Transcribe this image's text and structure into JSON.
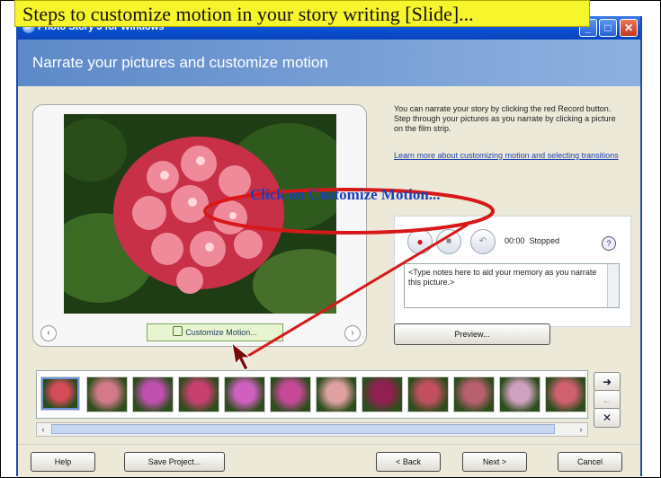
{
  "caption": "Steps to customize motion in your story writing [Slide]...",
  "window": {
    "title": "Photo Story 3 for Windows",
    "minimize_label": "_",
    "maximize_label": "□",
    "close_label": "✕"
  },
  "header": {
    "title": "Narrate your pictures and customize motion"
  },
  "preview": {
    "annotation": "Click on Customize Motion...",
    "prev_label": "‹",
    "next_label": "›",
    "customize_motion_label": "Customize Motion..."
  },
  "info": {
    "text": "You can narrate your story by clicking the red Record button. Step through your pictures as you narrate by clicking a picture on the film strip.",
    "link": "Learn more about customizing motion and selecting transitions"
  },
  "recording": {
    "record_icon": "●",
    "stop_icon": "■",
    "undo_icon": "↶",
    "time": "00:00",
    "status": "Stopped",
    "help_icon": "?",
    "notes_placeholder": "<Type notes here to aid your memory as you narrate this picture.>"
  },
  "preview_button": "Preview...",
  "filmstrip": {
    "thumbs": [
      {
        "c": "#d84a5a"
      },
      {
        "c": "#d27a8a"
      },
      {
        "c": "#c050b0"
      },
      {
        "c": "#c94070"
      },
      {
        "c": "#d060c0"
      },
      {
        "c": "#c84898"
      },
      {
        "c": "#e0a0a0"
      },
      {
        "c": "#902050"
      },
      {
        "c": "#c05060"
      },
      {
        "c": "#b86070"
      },
      {
        "c": "#d0a0c0"
      },
      {
        "c": "#d06070"
      }
    ],
    "right_label": "➜",
    "left_label": "←",
    "remove_label": "✕",
    "scroll_left": "‹",
    "scroll_right": "›"
  },
  "footer": {
    "help": "Help",
    "save": "Save Project...",
    "back": "< Back",
    "next": "Next >",
    "cancel": "Cancel"
  },
  "colors": {
    "accent": "#0a4fd0",
    "annotation_red": "#d81818"
  }
}
